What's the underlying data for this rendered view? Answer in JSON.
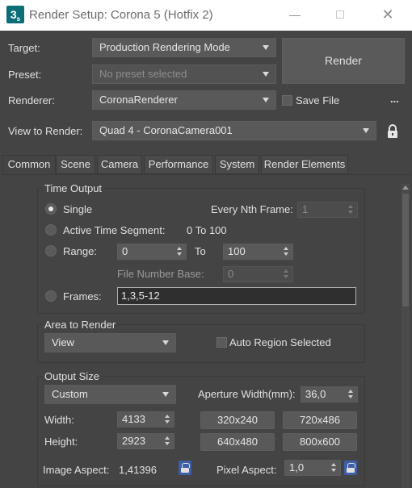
{
  "window": {
    "app_icon": "3",
    "app_icon_sub": "s",
    "title": "Render Setup: Corona 5 (Hotfix 2)"
  },
  "header": {
    "target_label": "Target:",
    "target_value": "Production Rendering Mode",
    "preset_label": "Preset:",
    "preset_value": "No preset selected",
    "renderer_label": "Renderer:",
    "renderer_value": "CoronaRenderer",
    "save_file_label": "Save File",
    "save_file_checked": false,
    "more_label": "...",
    "view_label": "View to Render:",
    "view_value": "Quad 4 - CoronaCamera001",
    "render_button": "Render"
  },
  "tabs": [
    {
      "label": "Common",
      "active": true
    },
    {
      "label": "Scene"
    },
    {
      "label": "Camera"
    },
    {
      "label": "Performance"
    },
    {
      "label": "System"
    },
    {
      "label": "Render Elements"
    }
  ],
  "time_output": {
    "title": "Time Output",
    "single_label": "Single",
    "every_nth_label": "Every Nth Frame:",
    "every_nth_value": "1",
    "active_segment_label": "Active Time Segment:",
    "active_segment_value": "0 To 100",
    "range_label": "Range:",
    "range_start": "0",
    "range_to": "To",
    "range_end": "100",
    "file_number_base_label": "File Number Base:",
    "file_number_base_value": "0",
    "frames_label": "Frames:",
    "frames_value": "1,3,5-12",
    "selected": "single"
  },
  "area_to_render": {
    "title": "Area to Render",
    "value": "View",
    "auto_region_label": "Auto Region Selected",
    "auto_region_checked": false
  },
  "output_size": {
    "title": "Output Size",
    "preset_value": "Custom",
    "aperture_label": "Aperture Width(mm):",
    "aperture_value": "36,0",
    "width_label": "Width:",
    "width_value": "4133",
    "height_label": "Height:",
    "height_value": "2923",
    "presets": [
      "320x240",
      "720x486",
      "640x480",
      "800x600"
    ],
    "image_aspect_label": "Image Aspect:",
    "image_aspect_value": "1,41396",
    "pixel_aspect_label": "Pixel Aspect:",
    "pixel_aspect_value": "1,0"
  },
  "icons": {
    "lock": "lock-icon",
    "link": "link-icon",
    "dropdown": "chevron-down-icon"
  }
}
